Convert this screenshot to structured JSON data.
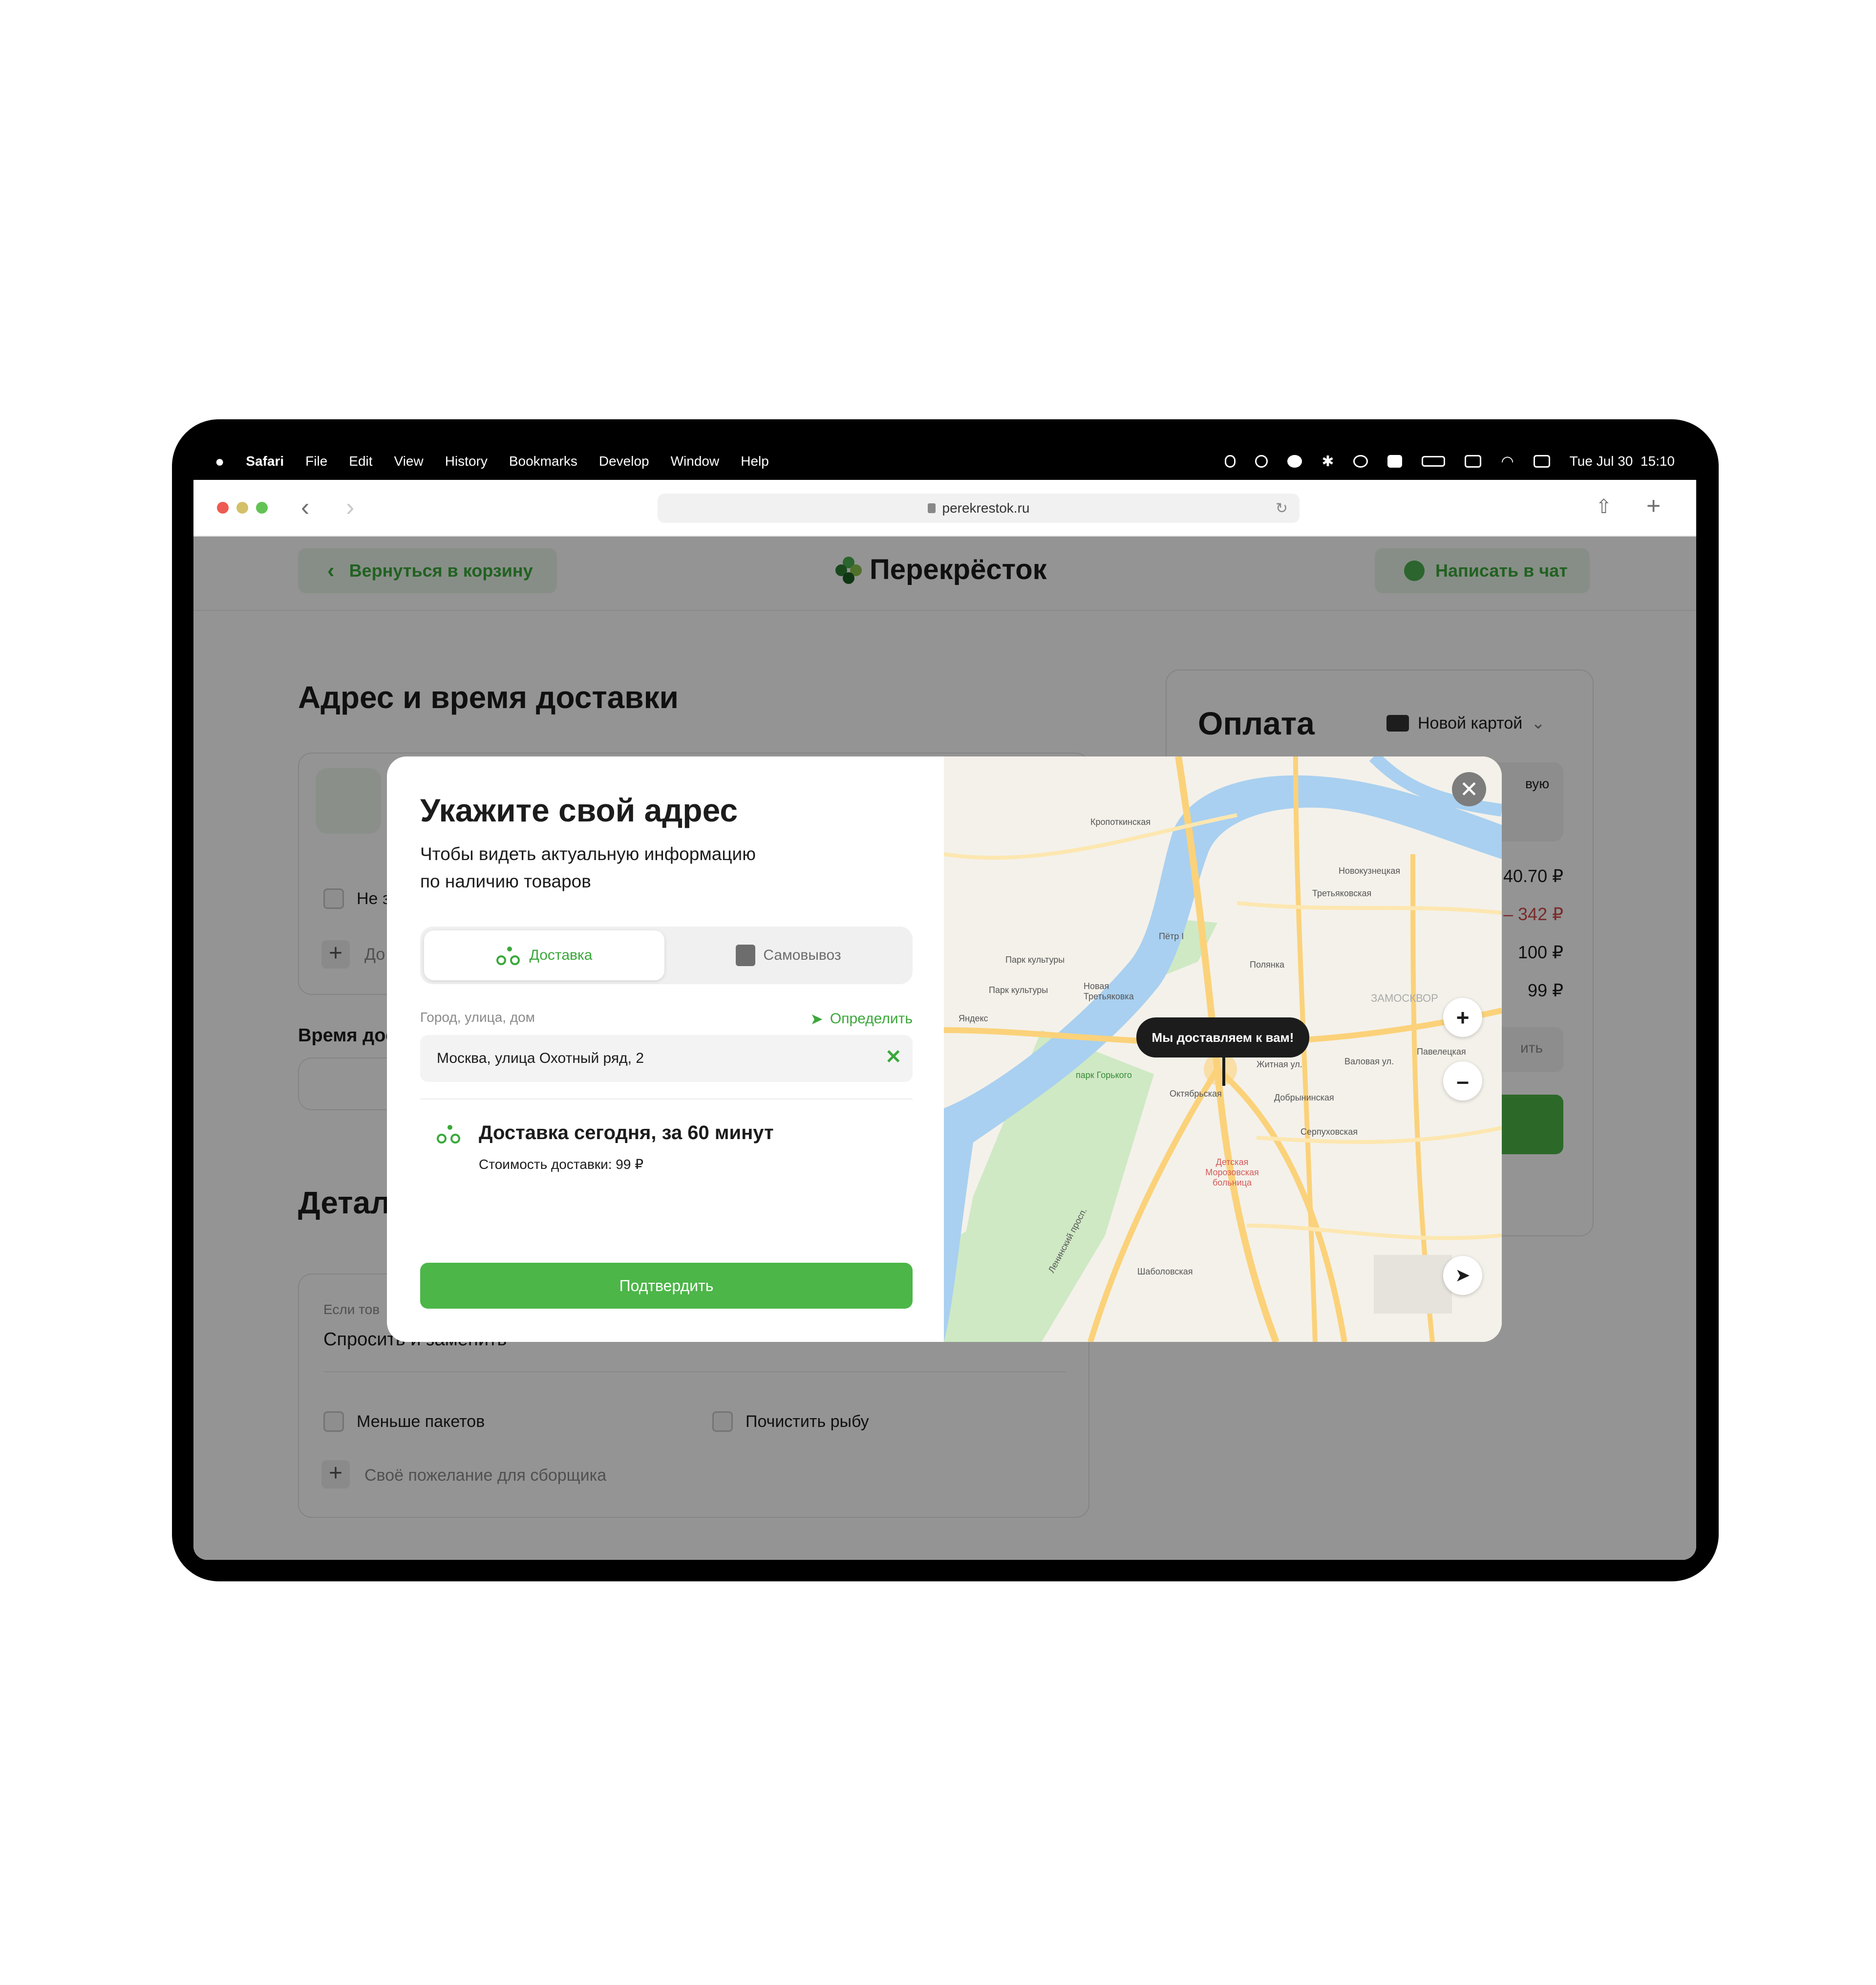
{
  "menubar": {
    "app": "Safari",
    "items": [
      "File",
      "Edit",
      "View",
      "History",
      "Bookmarks",
      "Develop",
      "Window",
      "Help"
    ],
    "clock": "Tue Jul 30  15:10"
  },
  "browser": {
    "url": "perekrestok.ru"
  },
  "header": {
    "back_label": "Вернуться в корзину",
    "logo_text": "Перекрёсток",
    "chat_label": "Написать в чат"
  },
  "delivery_section": {
    "title": "Адрес и время доставки",
    "checkbox_partial": "Не з",
    "add_partial": "До",
    "time_label_partial": "Время дос"
  },
  "details_section": {
    "title_partial": "Детал",
    "replace_hint_partial": "Если тов",
    "replace_value": "Спросить и заменить",
    "option_less_bags": "Меньше пакетов",
    "option_clean_fish": "Почистить рыбу",
    "wish_label": "Своё пожелание для сборщика"
  },
  "payment": {
    "title": "Оплата",
    "method": "Новой картой",
    "partial_text": "вую",
    "total_partial": "40.70 ₽",
    "discount_partial": "– 342 ₽",
    "row_100": "100 ₽",
    "row_99": "99 ₽",
    "apply_partial": "ить"
  },
  "modal": {
    "title": "Укажите свой адрес",
    "subtitle_line1": "Чтобы видеть актуальную информацию",
    "subtitle_line2": "по наличию товаров",
    "tab_delivery": "Доставка",
    "tab_pickup": "Самовывоз",
    "address_label": "Город, улица, дом",
    "detect_label": "Определить",
    "address_value": "Москва, улица Охотный ряд, 2",
    "delivery_title": "Доставка сегодня, за 60 минут",
    "delivery_cost": "Стоимость доставки: 99 ₽",
    "confirm_label": "Подтвердить",
    "map_tooltip": "Мы доставляем к вам!",
    "zoom_in": "+",
    "zoom_out": "–"
  },
  "map_labels": {
    "kropotkinskaya": "Кропоткинская",
    "novokuznetskaya": "Новокузнецкая",
    "tretyakovskaya": "Третьяковская",
    "polyanka": "Полянка",
    "park_kultury": "Парк культуры",
    "park_kultury2": "Парк культуры",
    "park_gorkogo": "парк Горького",
    "oktyabrskaya": "Октябрьская",
    "dobryninskaya": "Добрынинская",
    "serpukhovskaya": "Серпуховская",
    "paveletskaya": "Павелецкая",
    "shabolovskaya": "Шаболовская",
    "zamoskvorechye": "ЗАМОСКВОР",
    "zhitnaya": "Житная ул.",
    "valovaya": "Валовая ул.",
    "yandex": "Яндекс",
    "hospital": "Детская Морозовская больница",
    "novaya_tretyakovka": "Новая Третьяковка",
    "lenin_prospekt": "Ленинский просп.",
    "petr": "Пётр I"
  },
  "colors": {
    "brand_green": "#4cb648",
    "brand_green_text": "#3aa83a",
    "river": "#a9d0f0",
    "park": "#cfe9c4",
    "road": "#fbd27a"
  }
}
